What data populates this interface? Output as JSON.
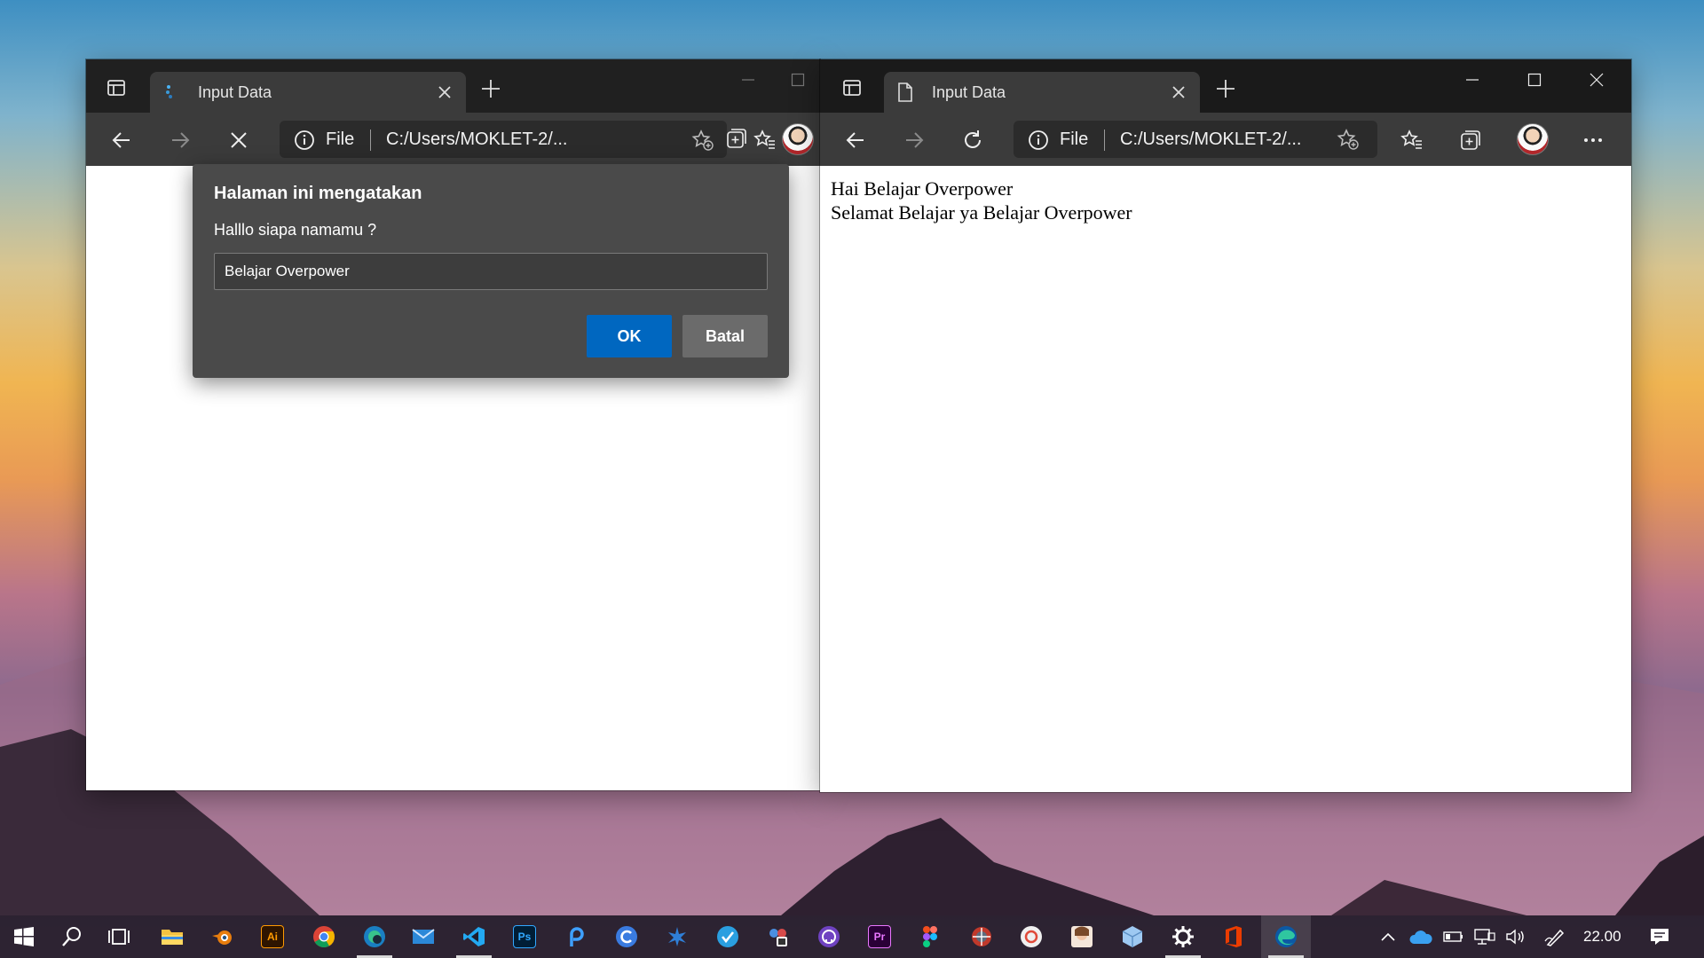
{
  "left_window": {
    "tab_title": "Input Data",
    "address_scheme": "File",
    "address_path": "C:/Users/MOKLET-2/...",
    "dialog": {
      "title": "Halaman ini mengatakan",
      "message": "Halllo siapa namamu ?",
      "input_value": "Belajar Overpower",
      "ok_label": "OK",
      "cancel_label": "Batal"
    }
  },
  "right_window": {
    "tab_title": "Input Data",
    "address_scheme": "File",
    "address_path": "C:/Users/MOKLET-2/...",
    "content_lines": [
      "Hai Belajar Overpower",
      "Selamat Belajar ya Belajar Overpower"
    ]
  },
  "taskbar": {
    "apps": [
      "start-icon",
      "search-icon",
      "task-view-icon",
      "file-explorer-icon",
      "blender-icon",
      "illustrator-icon",
      "chrome-icon",
      "edge-dev-icon",
      "mail-icon",
      "vscode-icon",
      "photoshop-icon",
      "app-icon",
      "canva-icon",
      "app-icon",
      "app-icon",
      "app-icon",
      "github-icon",
      "premiere-icon",
      "figma-icon",
      "app-icon",
      "app-icon",
      "app-icon",
      "app-icon",
      "settings-icon",
      "office-icon",
      "edge-icon"
    ],
    "illustrator_label": "Ai",
    "photoshop_label": "Ps",
    "premiere_label": "Pr",
    "clock": "22.00"
  }
}
